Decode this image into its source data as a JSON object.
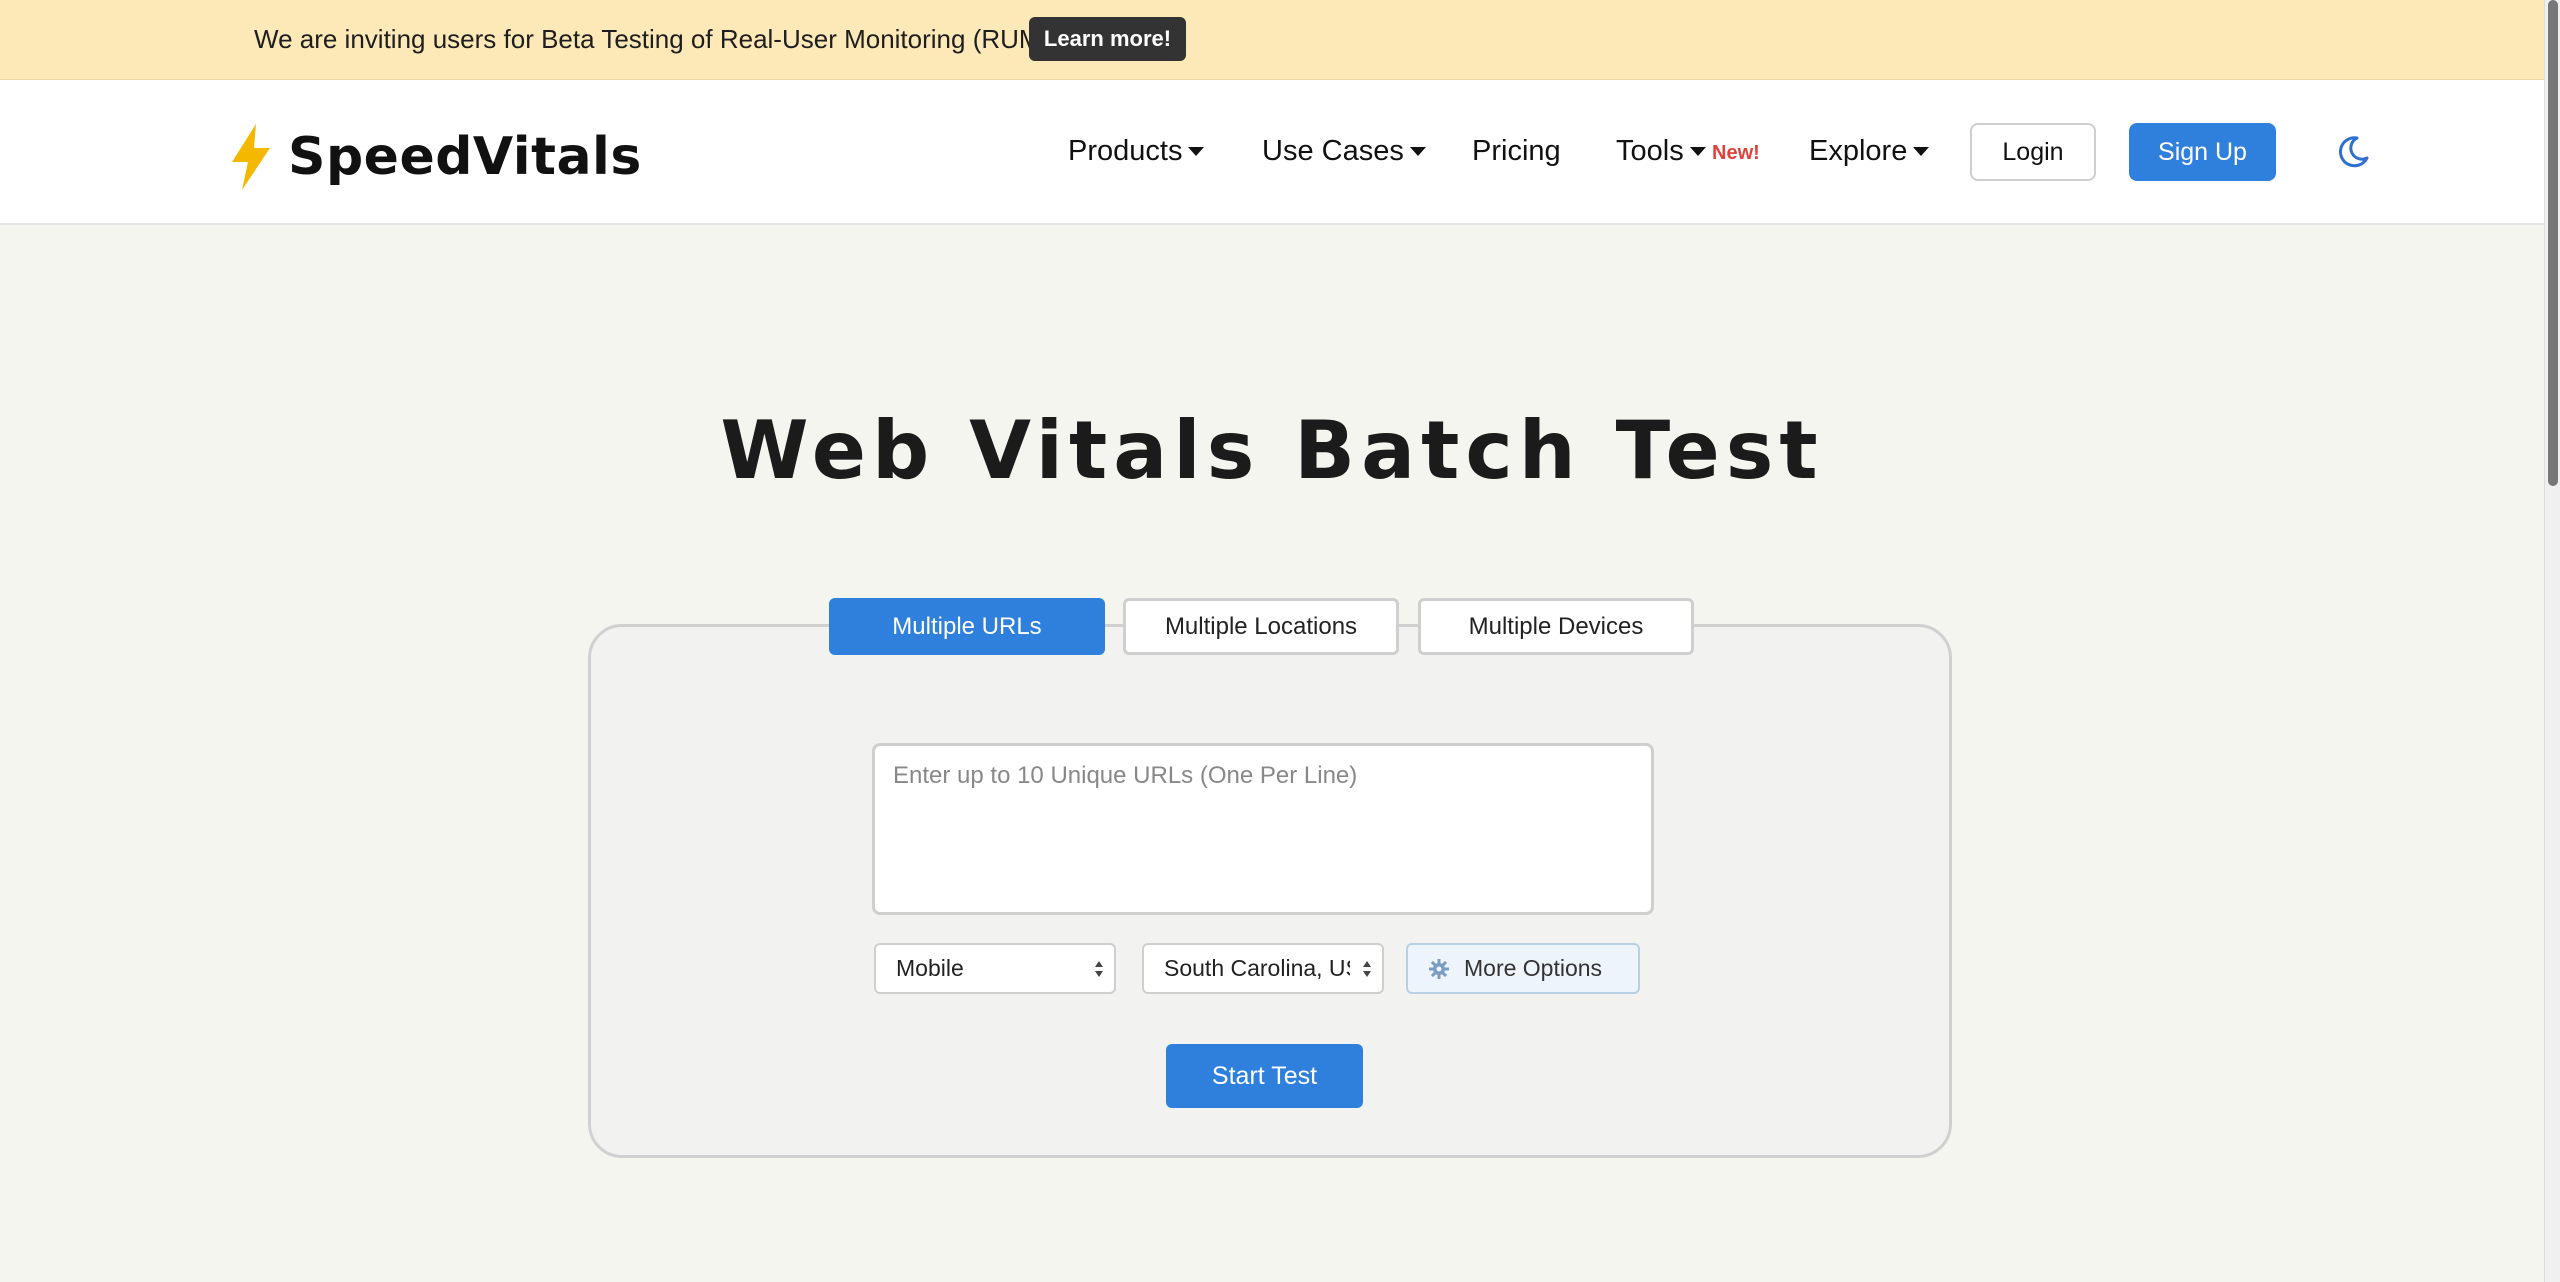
{
  "announcement": {
    "text": "We are inviting users for Beta Testing of Real-User Monitoring (RUM)",
    "button_label": "Learn more!"
  },
  "header": {
    "logo_text": "SpeedVitals",
    "nav": {
      "products": "Products",
      "use_cases": "Use Cases",
      "pricing": "Pricing",
      "tools": "Tools",
      "tools_badge": "New!",
      "explore": "Explore"
    },
    "login_label": "Login",
    "signup_label": "Sign Up",
    "theme_toggle_icon": "moon-icon"
  },
  "main": {
    "title": "Web Vitals Batch Test",
    "tabs": [
      {
        "label": "Multiple URLs",
        "active": true
      },
      {
        "label": "Multiple Locations",
        "active": false
      },
      {
        "label": "Multiple Devices",
        "active": false
      }
    ],
    "url_input": {
      "placeholder": "Enter up to 10 Unique URLs (One Per Line)",
      "value": ""
    },
    "device_select": {
      "value": "Mobile"
    },
    "location_select": {
      "value": "South Carolina, US"
    },
    "more_options_label": "More Options",
    "start_label": "Start Test"
  },
  "colors": {
    "accent": "#2f7fdd",
    "announcement_bg": "#fde9b8",
    "page_bg": "#f5f5ef",
    "logo_bolt": "#f5b800",
    "badge_red": "#e0413a"
  }
}
